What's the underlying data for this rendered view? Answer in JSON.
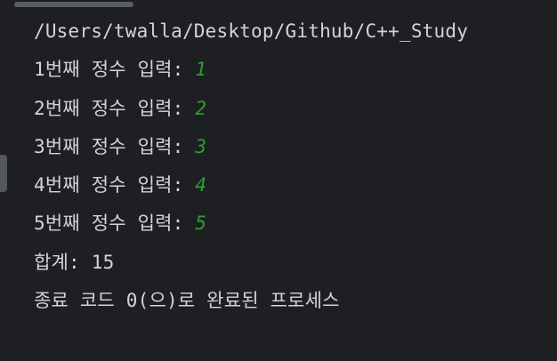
{
  "console": {
    "lines": {
      "path": "/Users/twalla/Desktop/Github/C++_Study",
      "prompt1": "1번째 정수 입력: ",
      "input1": "1",
      "prompt2": "2번째 정수 입력: ",
      "input2": "2",
      "prompt3": "3번째 정수 입력: ",
      "input3": "3",
      "prompt4": "4번째 정수 입력: ",
      "input4": "4",
      "prompt5": "5번째 정수 입력: ",
      "input5": "5",
      "sum": "합계: 15",
      "exit": "종료 코드 0(으)로 완료된 프로세스"
    }
  },
  "colors": {
    "background": "#1e1f22",
    "text": "#d2d4d8",
    "user_input": "#2f9e2f"
  }
}
